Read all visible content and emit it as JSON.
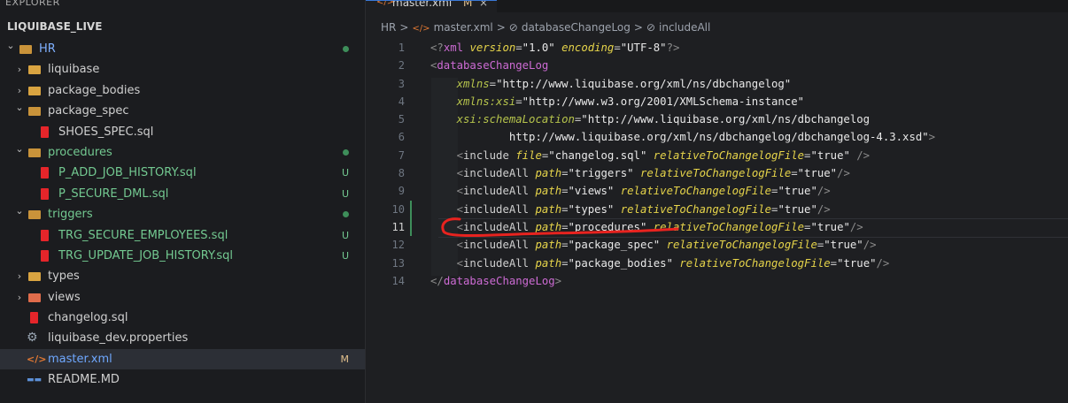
{
  "explorer": {
    "header": "EXPLORER",
    "more_icon": "ellipsis-icon",
    "root_label": "LIQUIBASE_LIVE",
    "items": [
      {
        "label": "HR",
        "type": "folder-open",
        "level": 0,
        "color": "#7fb0ff",
        "status": "dot"
      },
      {
        "label": "liquibase",
        "type": "folder",
        "level": 1
      },
      {
        "label": "package_bodies",
        "type": "folder",
        "level": 1
      },
      {
        "label": "package_spec",
        "type": "folder-open",
        "level": 1
      },
      {
        "label": "SHOES_SPEC.sql",
        "type": "sql",
        "level": 2
      },
      {
        "label": "procedures",
        "type": "folder-open",
        "level": 1,
        "color": "#73c991",
        "status": "dot"
      },
      {
        "label": "P_ADD_JOB_HISTORY.sql",
        "type": "sql",
        "level": 2,
        "color": "#73c991",
        "badge": "U"
      },
      {
        "label": "P_SECURE_DML.sql",
        "type": "sql",
        "level": 2,
        "color": "#73c991",
        "badge": "U"
      },
      {
        "label": "triggers",
        "type": "folder-open",
        "level": 1,
        "color": "#73c991",
        "status": "dot"
      },
      {
        "label": "TRG_SECURE_EMPLOYEES.sql",
        "type": "sql",
        "level": 2,
        "color": "#73c991",
        "badge": "U"
      },
      {
        "label": "TRG_UPDATE_JOB_HISTORY.sql",
        "type": "sql",
        "level": 2,
        "color": "#73c991",
        "badge": "U"
      },
      {
        "label": "types",
        "type": "folder",
        "level": 1
      },
      {
        "label": "views",
        "type": "folder-red",
        "level": 1
      },
      {
        "label": "changelog.sql",
        "type": "sql",
        "level": 1
      },
      {
        "label": "liquibase_dev.properties",
        "type": "gear",
        "level": 1
      },
      {
        "label": "master.xml",
        "type": "xml",
        "level": 1,
        "color": "#6fa8ff",
        "badge": "M",
        "selected": true
      },
      {
        "label": "README.MD",
        "type": "md",
        "level": 1
      }
    ]
  },
  "tab": {
    "label": "master.xml",
    "modified": "M",
    "close": "×",
    "icon": "xml-file-icon"
  },
  "breadcrumb": [
    "HR",
    "master.xml",
    "databaseChangeLog",
    "includeAll"
  ],
  "breadcrumb_sep": ">",
  "editor": {
    "active_line": 11,
    "lines": [
      {
        "n": "1",
        "tokens": [
          [
            "br",
            "<?"
          ],
          [
            "tag",
            "xml"
          ],
          [
            "txt",
            " "
          ],
          [
            "attr",
            "version"
          ],
          [
            "eq",
            "="
          ],
          [
            "str",
            "\"1.0\""
          ],
          [
            "txt",
            " "
          ],
          [
            "attr",
            "encoding"
          ],
          [
            "eq",
            "="
          ],
          [
            "str",
            "\"UTF-8\""
          ],
          [
            "br",
            "?>"
          ]
        ]
      },
      {
        "n": "2",
        "tokens": [
          [
            "br",
            "<"
          ],
          [
            "tag",
            "databaseChangeLog"
          ]
        ]
      },
      {
        "n": "3",
        "tokens": [
          [
            "txt",
            "    "
          ],
          [
            "attr2",
            "xmlns"
          ],
          [
            "eq",
            "="
          ],
          [
            "str",
            "\"http://www.liquibase.org/xml/ns/dbchangelog\""
          ]
        ]
      },
      {
        "n": "4",
        "tokens": [
          [
            "txt",
            "    "
          ],
          [
            "attr2",
            "xmlns:xsi"
          ],
          [
            "eq",
            "="
          ],
          [
            "str",
            "\"http://www.w3.org/2001/XMLSchema-instance\""
          ]
        ]
      },
      {
        "n": "5",
        "tokens": [
          [
            "txt",
            "    "
          ],
          [
            "attr2",
            "xsi:schemaLocation"
          ],
          [
            "eq",
            "="
          ],
          [
            "str",
            "\"http://www.liquibase.org/xml/ns/dbchangelog"
          ]
        ]
      },
      {
        "n": "6",
        "tokens": [
          [
            "txt",
            "            "
          ],
          [
            "str",
            "http://www.liquibase.org/xml/ns/dbchangelog/dbchangelog-4.3.xsd\""
          ],
          [
            "br",
            ">"
          ]
        ]
      },
      {
        "n": "7",
        "tokens": [
          [
            "txt",
            "    "
          ],
          [
            "br",
            "<"
          ],
          [
            "txt",
            "include"
          ],
          [
            "txt",
            " "
          ],
          [
            "attr",
            "file"
          ],
          [
            "eq",
            "="
          ],
          [
            "str",
            "\"changelog.sql\""
          ],
          [
            "txt",
            " "
          ],
          [
            "attr",
            "relativeToChangelogFile"
          ],
          [
            "eq",
            "="
          ],
          [
            "str",
            "\"true\""
          ],
          [
            "txt",
            " "
          ],
          [
            "br",
            "/>"
          ]
        ]
      },
      {
        "n": "8",
        "tokens": [
          [
            "txt",
            "    "
          ],
          [
            "br",
            "<"
          ],
          [
            "txt",
            "includeAll"
          ],
          [
            "txt",
            " "
          ],
          [
            "attr",
            "path"
          ],
          [
            "eq",
            "="
          ],
          [
            "str",
            "\"triggers\""
          ],
          [
            "txt",
            " "
          ],
          [
            "attr",
            "relativeToChangelogFile"
          ],
          [
            "eq",
            "="
          ],
          [
            "str",
            "\"true\""
          ],
          [
            "br",
            "/>"
          ]
        ]
      },
      {
        "n": "9",
        "tokens": [
          [
            "txt",
            "    "
          ],
          [
            "br",
            "<"
          ],
          [
            "txt",
            "includeAll"
          ],
          [
            "txt",
            " "
          ],
          [
            "attr",
            "path"
          ],
          [
            "eq",
            "="
          ],
          [
            "str",
            "\"views\""
          ],
          [
            "txt",
            " "
          ],
          [
            "attr",
            "relativeToChangelogFile"
          ],
          [
            "eq",
            "="
          ],
          [
            "str",
            "\"true\""
          ],
          [
            "br",
            "/>"
          ]
        ]
      },
      {
        "n": "10",
        "tokens": [
          [
            "txt",
            "    "
          ],
          [
            "br",
            "<"
          ],
          [
            "txt",
            "includeAll"
          ],
          [
            "txt",
            " "
          ],
          [
            "attr",
            "path"
          ],
          [
            "eq",
            "="
          ],
          [
            "str",
            "\"types\""
          ],
          [
            "txt",
            " "
          ],
          [
            "attr",
            "relativeToChangelogFile"
          ],
          [
            "eq",
            "="
          ],
          [
            "str",
            "\"true\""
          ],
          [
            "br",
            "/>"
          ]
        ]
      },
      {
        "n": "11",
        "tokens": [
          [
            "txt",
            "    "
          ],
          [
            "br",
            "<"
          ],
          [
            "txt",
            "includeAll"
          ],
          [
            "txt",
            " "
          ],
          [
            "attr",
            "path"
          ],
          [
            "eq",
            "="
          ],
          [
            "str",
            "\"procedures\""
          ],
          [
            "txt",
            " "
          ],
          [
            "attr",
            "relativeToChangelogFile"
          ],
          [
            "eq",
            "="
          ],
          [
            "str",
            "\"true\""
          ],
          [
            "br",
            "/>"
          ]
        ]
      },
      {
        "n": "12",
        "tokens": [
          [
            "txt",
            "    "
          ],
          [
            "br",
            "<"
          ],
          [
            "txt",
            "includeAll"
          ],
          [
            "txt",
            " "
          ],
          [
            "attr",
            "path"
          ],
          [
            "eq",
            "="
          ],
          [
            "str",
            "\"package_spec\""
          ],
          [
            "txt",
            " "
          ],
          [
            "attr",
            "relativeToChangelogFile"
          ],
          [
            "eq",
            "="
          ],
          [
            "str",
            "\"true\""
          ],
          [
            "br",
            "/>"
          ]
        ]
      },
      {
        "n": "13",
        "tokens": [
          [
            "txt",
            "    "
          ],
          [
            "br",
            "<"
          ],
          [
            "txt",
            "includeAll"
          ],
          [
            "txt",
            " "
          ],
          [
            "attr",
            "path"
          ],
          [
            "eq",
            "="
          ],
          [
            "str",
            "\"package_bodies\""
          ],
          [
            "txt",
            " "
          ],
          [
            "attr",
            "relativeToChangelogFile"
          ],
          [
            "eq",
            "="
          ],
          [
            "str",
            "\"true\""
          ],
          [
            "br",
            "/>"
          ]
        ]
      },
      {
        "n": "14",
        "tokens": [
          [
            "br",
            "</"
          ],
          [
            "tag",
            "databaseChangeLog"
          ],
          [
            "br",
            ">"
          ]
        ]
      }
    ]
  },
  "annotation": {
    "shape": "red-hand-drawn-underline",
    "color": "#e8231f"
  }
}
